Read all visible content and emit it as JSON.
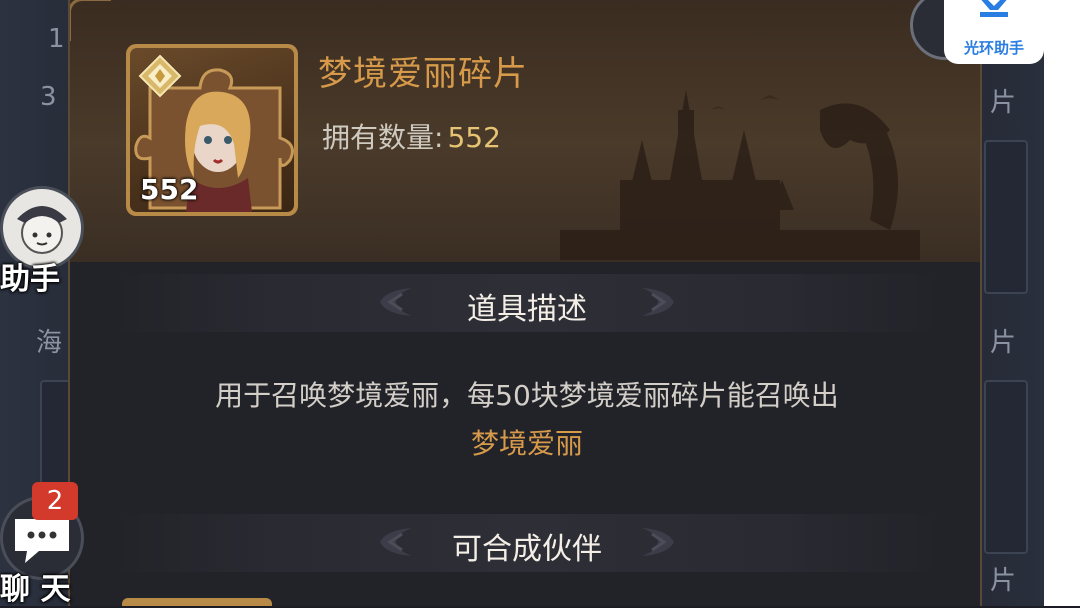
{
  "background": {
    "left_texts": [
      "1",
      "3",
      "海"
    ],
    "right_texts": [
      "片",
      "片",
      "片"
    ]
  },
  "item": {
    "title": "梦境爱丽碎片",
    "count_badge": "552",
    "own_label": "拥有数量:",
    "own_value": "552"
  },
  "sections": {
    "description_title": "道具描述",
    "description_text": "用于召唤梦境爱丽，每50块梦境爱丽碎片能召唤出",
    "description_highlight": "梦境爱丽",
    "combine_title": "可合成伙伴"
  },
  "side": {
    "assistant_label": "助手",
    "chat_label": "聊 天",
    "chat_badge": "2"
  },
  "logo": {
    "text": "光环助手"
  },
  "colors": {
    "accent_gold": "#d69a4a",
    "value_gold": "#e6c474",
    "badge_red": "#d33a2c",
    "logo_blue": "#2a7de1"
  },
  "icons": [
    "puzzle-piece-portrait-icon",
    "gold-diamond-icon",
    "chat-bubble-icon",
    "assistant-avatar-icon"
  ]
}
